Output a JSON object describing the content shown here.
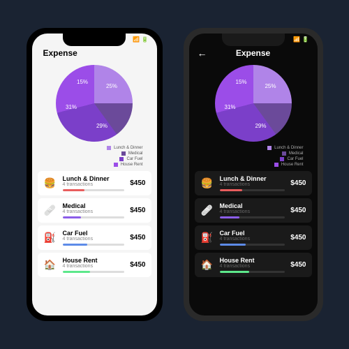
{
  "status": {
    "time": "",
    "signal": "",
    "wifi": "",
    "battery": ""
  },
  "title": "Expense",
  "chart_data": {
    "type": "pie",
    "series": [
      {
        "name": "Lunch & Dinner",
        "value": 25,
        "label": "25%",
        "color": "#b084e8"
      },
      {
        "name": "Medical",
        "value": 15,
        "label": "15%",
        "color": "#6b4a9a"
      },
      {
        "name": "Car Fuel",
        "value": 31,
        "label": "31%",
        "color": "#7b3fc9"
      },
      {
        "name": "House Rent",
        "value": 29,
        "label": "29%",
        "color": "#9b4de8"
      }
    ]
  },
  "legend": [
    {
      "label": "Lunch & Dinner",
      "color": "#b084e8"
    },
    {
      "label": "Medical",
      "color": "#6b4a9a"
    },
    {
      "label": "Car Fuel",
      "color": "#7b3fc9"
    },
    {
      "label": "House Rent",
      "color": "#9b4de8"
    }
  ],
  "categories": [
    {
      "icon": "🍔",
      "icon_name": "burger-icon",
      "name": "Lunch & Dinner",
      "sub": "4 transactions",
      "amount": "$450",
      "bar_color": "#e85d5d",
      "bar_pct": 35
    },
    {
      "icon": "🩹",
      "icon_name": "medkit-icon",
      "name": "Medical",
      "sub": "4 transactions",
      "amount": "$450",
      "bar_color": "#8b5de8",
      "bar_pct": 30
    },
    {
      "icon": "⛽",
      "icon_name": "fuel-icon",
      "name": "Car Fuel",
      "sub": "4 transactions",
      "amount": "$450",
      "bar_color": "#5d8be8",
      "bar_pct": 40
    },
    {
      "icon": "🏠",
      "icon_name": "house-icon",
      "name": "House Rent",
      "sub": "4 transactions",
      "amount": "$450",
      "bar_color": "#5de88b",
      "bar_pct": 45
    }
  ],
  "colors": {
    "bg": "#1a2332",
    "accent_purple": "#9b4de8"
  }
}
